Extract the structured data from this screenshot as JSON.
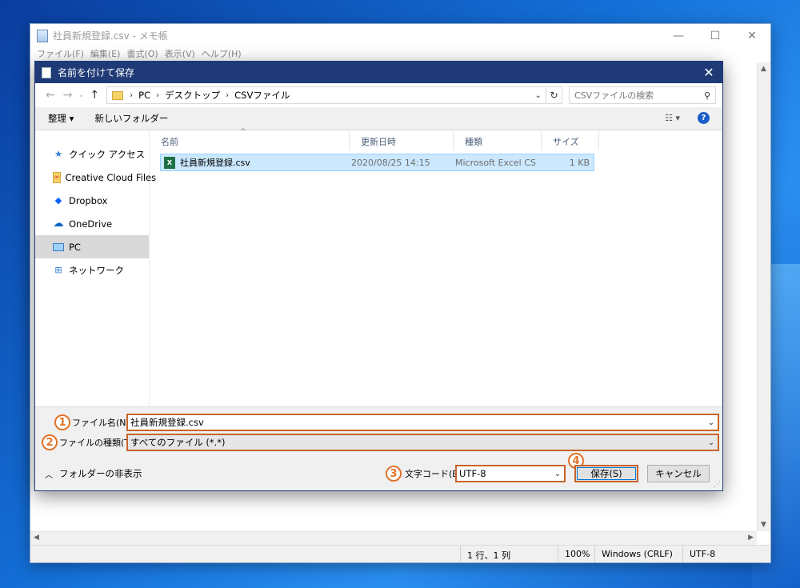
{
  "notepad": {
    "title": "社員新規登録.csv - メモ帳",
    "window_buttons": [
      "—",
      "☐",
      "✕"
    ],
    "menu": [
      "ファイル(F)",
      "編集(E)",
      "書式(O)",
      "表示(V)",
      "ヘルプ(H)"
    ],
    "status": {
      "position": "1 行、1 列",
      "zoom": "100%",
      "line_ending": "Windows (CRLF)",
      "encoding": "UTF-8"
    }
  },
  "dialog": {
    "title": "名前を付けて保存",
    "close": "✕",
    "path": [
      "PC",
      "デスクトップ",
      "CSVファイル"
    ],
    "search_placeholder": "CSVファイルの検索",
    "organize": "整理 ▾",
    "new_folder": "新しいフォルダー",
    "view_label": "☷ ▾",
    "help": "?",
    "nav_items": [
      {
        "label": "クイック アクセス",
        "icon": "star-icon"
      },
      {
        "label": "Creative Cloud Files",
        "icon": "creative-cloud-icon"
      },
      {
        "label": "Dropbox",
        "icon": "dropbox-icon"
      },
      {
        "label": "OneDrive",
        "icon": "cloud-icon"
      },
      {
        "label": "PC",
        "icon": "computer-icon"
      },
      {
        "label": "ネットワーク",
        "icon": "network-icon"
      }
    ],
    "columns": [
      "名前",
      "更新日時",
      "種類",
      "サイズ"
    ],
    "files": [
      {
        "name": "社員新規登録.csv",
        "modified": "2020/08/25 14:15",
        "type": "Microsoft Excel CS...",
        "size": "1 KB"
      }
    ],
    "filename_label": "ファイル名(N):",
    "filename_value": "社員新規登録.csv",
    "filetype_label": "ファイルの種類(T):",
    "filetype_value": "すべてのファイル (*.*)",
    "encoding_label": "文字コード(E):",
    "encoding_value": "UTF-8",
    "save_button": "保存(S)",
    "cancel_button": "キャンセル",
    "hide_folders": "フォルダーの非表示",
    "badges": [
      "1",
      "2",
      "3",
      "4"
    ]
  },
  "colors": {
    "dialog_title_bg": "#1f3a76",
    "highlight_border": "#c8642a",
    "selection_bg": "#cce8ff"
  }
}
